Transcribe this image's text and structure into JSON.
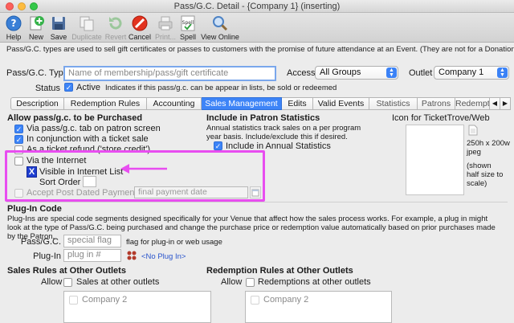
{
  "window": {
    "title": "Pass/G.C. Detail - {Company 1} (inserting)"
  },
  "toolbar": {
    "help": "Help",
    "new": "New",
    "save": "Save",
    "duplicate": "Duplicate",
    "revert": "Revert",
    "cancel": "Cancel",
    "print": "Print...",
    "spell": "Spell",
    "view_online": "View Online",
    "spell_badge": "Spell"
  },
  "description": "Pass/G.C. types are used to sell gift certificates or passes to customers with the promise of future attendance at an Event.  (They are not for a Donation).",
  "form": {
    "type_label": "Pass/G.C. Type",
    "type_placeholder": "Name of membership/pass/gift certificate",
    "access_label": "Access",
    "access_value": "All Groups",
    "outlet_label": "Outlet",
    "outlet_value": "Company 1",
    "status_label": "Status",
    "status_value": "Active",
    "status_note": "Indicates if this pass/g.c. can be appear in lists, be sold or redeemed"
  },
  "tabs": [
    "Description",
    "Redemption Rules",
    "Accounting",
    "Sales Management",
    "Edits",
    "Valid Events",
    "Statistics",
    "Patrons",
    "Redempti"
  ],
  "active_tab": "Sales Management",
  "purchase": {
    "heading": "Allow pass/g.c. to be Purchased",
    "via_tab": "Via pass/g.c. tab on patron screen",
    "conjunction": "In conjunction with a ticket sale",
    "refund": "As a ticket refund ('store credit')",
    "internet": "Via the Internet",
    "visible": "Visible in Internet List",
    "sort_order": "Sort Order",
    "post_dated": "Accept Post Dated Payments",
    "final_payment_placeholder": "final payment date"
  },
  "stats": {
    "heading": "Include in Patron Statistics",
    "note": "Annual statistics track sales on a per program year basis.  Include/exclude this if desired.",
    "annual": "Include in Annual Statistics"
  },
  "icon_panel": {
    "heading": "Icon for TicketTrove/Web",
    "size": "250h x 200w jpeg",
    "note": "(shown half size to scale)"
  },
  "plugin": {
    "heading": "Plug-In Code",
    "description": "Plug-Ins are special code segments designed specifically for your Venue that affect how the sales process works.  For example, a plug in might look at the type of Pass/G.C. being purchased and change the purchase price or redemption value automatically based on prior purchases made by the Patron.",
    "passgc_label": "Pass/G.C.",
    "passgc_placeholder": "special flag",
    "passgc_note": "flag for plug-in or web usage",
    "plugin_label": "Plug-In",
    "plugin_placeholder": "plug in #",
    "no_plugin": "<No Plug In>"
  },
  "sales_rules": {
    "heading": "Sales Rules at Other Outlets",
    "allow": "Allow",
    "check_label": "Sales at other outlets",
    "item": "Company 2"
  },
  "redemption_rules": {
    "heading": "Redemption Rules at Other Outlets",
    "allow": "Allow",
    "check_label": "Redemptions at other outlets",
    "item": "Company 2"
  },
  "colors": {
    "accent": "#3d84f7",
    "highlight": "#e84df0"
  }
}
